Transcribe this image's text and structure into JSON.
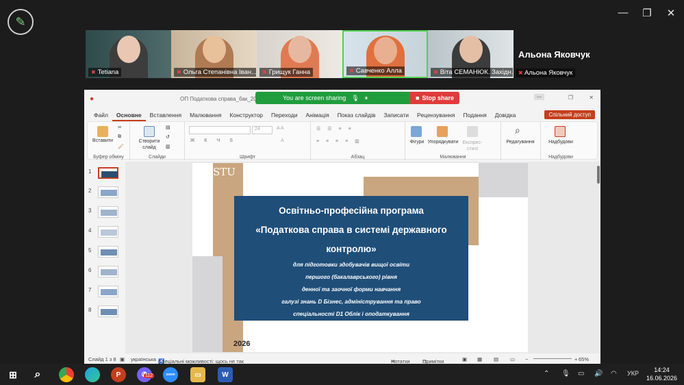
{
  "zoom": {
    "participants": [
      {
        "name": "Tetiana"
      },
      {
        "name": "Ольга Степанівна Іван..."
      },
      {
        "name": "Грищук Ганна"
      },
      {
        "name": "Савченко Алла"
      },
      {
        "name": "Віта СЕМАНЮК. Західн..."
      }
    ],
    "big_name": "Альона Яковчук",
    "small_name": "Альона Яковчук",
    "share_text": "You are screen sharing",
    "stop_share": "Stop share"
  },
  "ppt": {
    "title": "ОП Податкова справа_бак_2026 (3) ·",
    "menu": [
      "Файл",
      "Основне",
      "Вставлення",
      "Малювання",
      "Конструктор",
      "Переходи",
      "Анімація",
      "Показ слайдів",
      "Записати",
      "Рецензування",
      "Подання",
      "Довідка"
    ],
    "share_access": "Спільний доступ",
    "ribbon": {
      "paste": "Вставити",
      "clipboard": "Буфер обміну",
      "new_slide": "Створити слайд",
      "slides": "Слайди",
      "font": "Шрифт",
      "font_size": "24",
      "paragraph": "Абзац",
      "shapes": "Фігури",
      "arrange": "Упорядкувати",
      "express": "Експрес-стилі",
      "drawing": "Малювання",
      "editing": "Редагування",
      "addins": "Надбудови",
      "addins_group": "Надбудови"
    },
    "thumb_numbers": [
      "1",
      "2",
      "3",
      "4",
      "5",
      "6",
      "7",
      "8"
    ],
    "slide": {
      "logo": "STU",
      "title1": "Освітньо-професійна програма",
      "title2": "«Податкова справа в системі державного",
      "title3": "контролю»",
      "sub1": "для підготовки здобувачів вищої освіти",
      "sub2": "першого (бакалаврського) рівня",
      "sub3": "денної та заочної форми навчання",
      "sub4": "галузі знань D Бізнес, адміністрування та право",
      "sub5": "спеціальності D1 Облік і оподаткування",
      "year": "2026"
    },
    "status": {
      "slide_of": "Слайд 1 з 8",
      "lang": "українська",
      "accessibility": "Спеціальні можливості: щось не так",
      "notes": "Нотатки",
      "comments": "Примітки",
      "zoom": "65%"
    }
  },
  "taskbar": {
    "viber_badge": "112",
    "lang": "УКР",
    "time": "14:24",
    "date": "16.06.2026"
  }
}
